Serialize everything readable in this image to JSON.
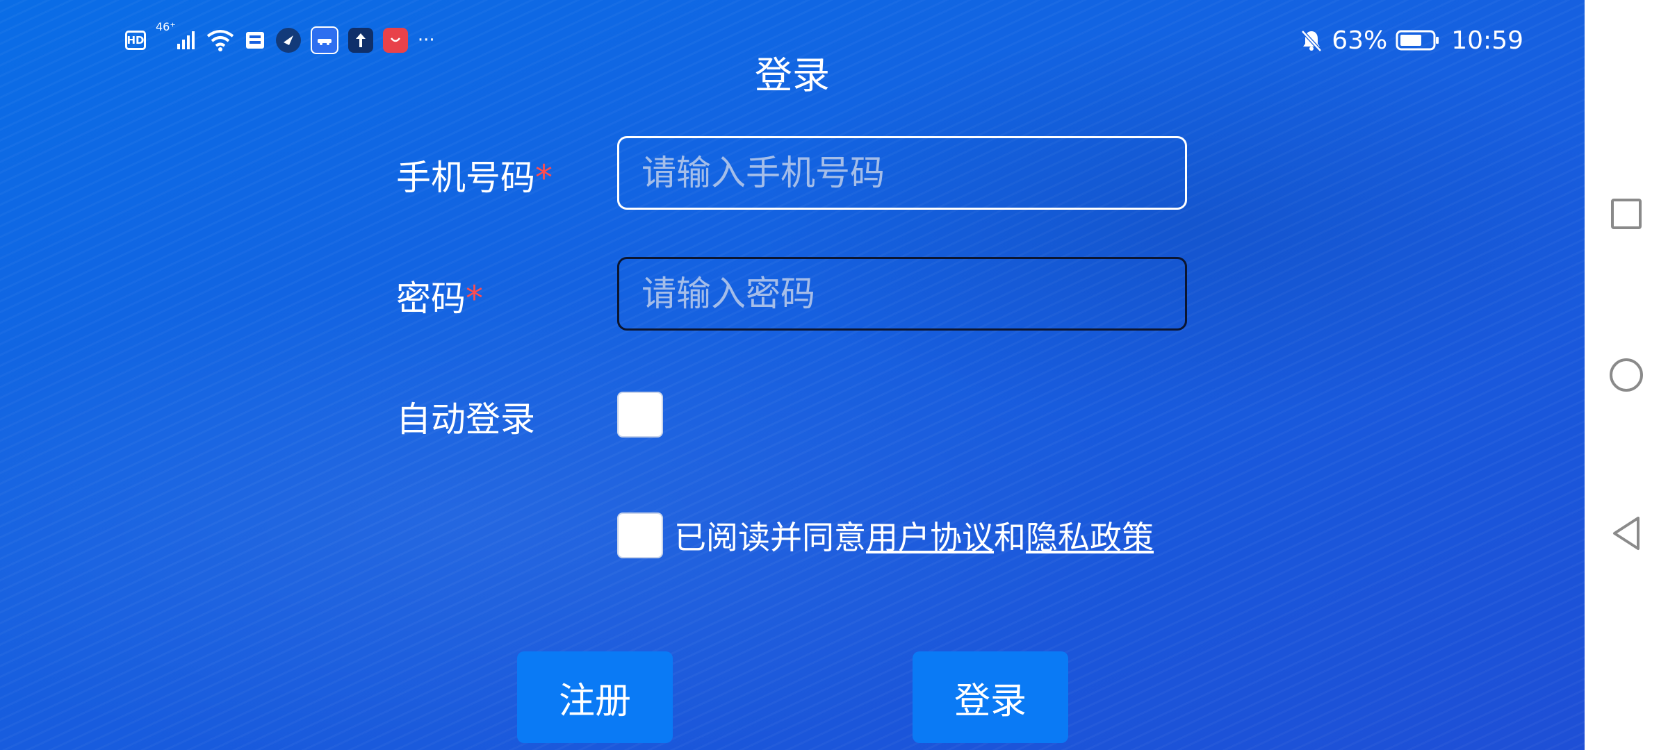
{
  "status_bar": {
    "left_icons": [
      "hd-icon",
      "signal-4g-icon",
      "wifi-icon",
      "card-icon",
      "app-shield-icon",
      "app-car-icon",
      "upload-icon",
      "huawei-store-icon"
    ],
    "network_label": "46⁺",
    "hd_label": "HD",
    "more": "···",
    "battery_percent": "63%",
    "time": "10:59"
  },
  "page": {
    "title": "登录"
  },
  "form": {
    "phone_label": "手机号码",
    "phone_placeholder": "请输入手机号码",
    "password_label": "密码",
    "password_placeholder": "请输入密码",
    "required_mark": "*",
    "auto_login_label": "自动登录",
    "agree_prefix": "已阅读并同意",
    "user_agreement": "用户协议",
    "and": "和",
    "privacy_policy": "隐私政策"
  },
  "buttons": {
    "register": "注册",
    "login": "登录"
  },
  "nav_bar": {
    "icons": [
      "recent-apps-icon",
      "home-icon",
      "back-icon"
    ]
  },
  "colors": {
    "background_start": "#0a6de6",
    "background_end": "#1e4fd6",
    "button": "#0a7af5",
    "required": "#ff4d4f"
  }
}
